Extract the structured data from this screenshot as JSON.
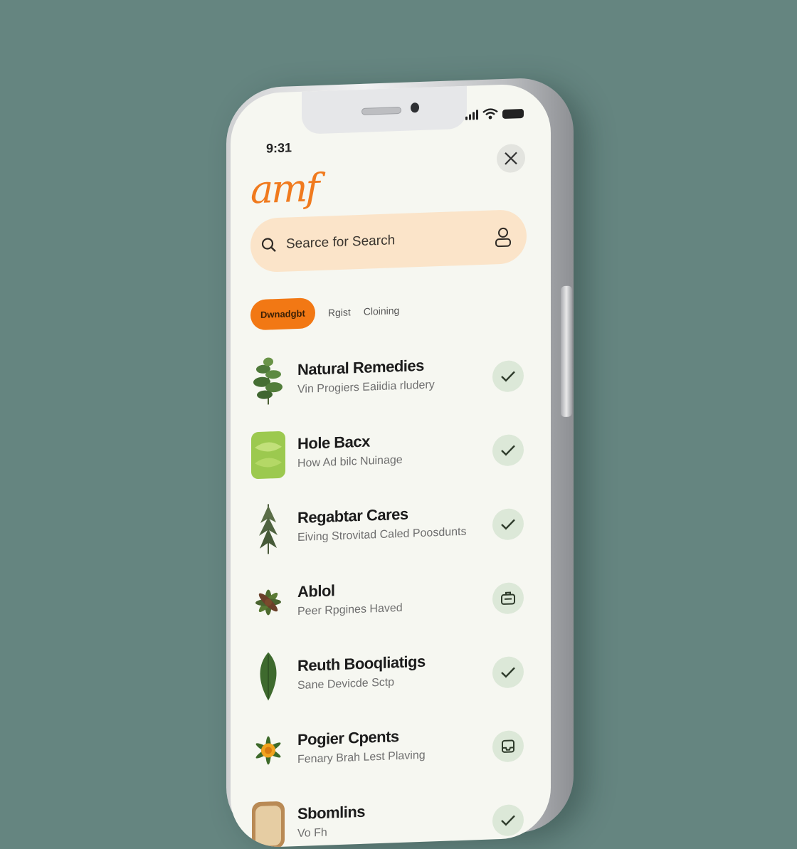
{
  "status_bar": {
    "time": "9:31"
  },
  "app": {
    "logo": "amf"
  },
  "search": {
    "placeholder": "Searce for Search"
  },
  "tabs": [
    {
      "label": "Dwnadgbt",
      "active": true
    },
    {
      "label": "Rgist",
      "active": false
    },
    {
      "label": "Cloining",
      "active": false
    }
  ],
  "items": [
    {
      "title": "Natural Remedies",
      "subtitle": "Vin Progiers Eaiidia rludery",
      "thumb": "herb-sprig",
      "action": "check-icon"
    },
    {
      "title": "Hole Bacx",
      "subtitle": "How Ad bilc Nuinage",
      "thumb": "green-leaves",
      "action": "check-icon"
    },
    {
      "title": "Regabtar Cares",
      "subtitle": "Eiving Strovitad Caled Poosdunts",
      "thumb": "conifer-sprig",
      "action": "check-icon"
    },
    {
      "title": "Ablol",
      "subtitle": "Peer Rpgines Haved",
      "thumb": "leaf-rosette",
      "action": "briefcase-icon"
    },
    {
      "title": "Reuth Booqliatigs",
      "subtitle": "Sane Devicde Sctp",
      "thumb": "single-leaf",
      "action": "check-icon"
    },
    {
      "title": "Pogier Cpents",
      "subtitle": "Fenary Brah Lest Plaving",
      "thumb": "marigold-flower",
      "action": "tray-icon"
    },
    {
      "title": "Sbomlins",
      "subtitle": "Vo Fh",
      "thumb": "bread-slice",
      "action": "check-icon"
    }
  ],
  "colors": {
    "accent": "#f27814",
    "search_bg": "#fbe4c9",
    "check_bg": "#dce8d8",
    "background": "#658580"
  }
}
